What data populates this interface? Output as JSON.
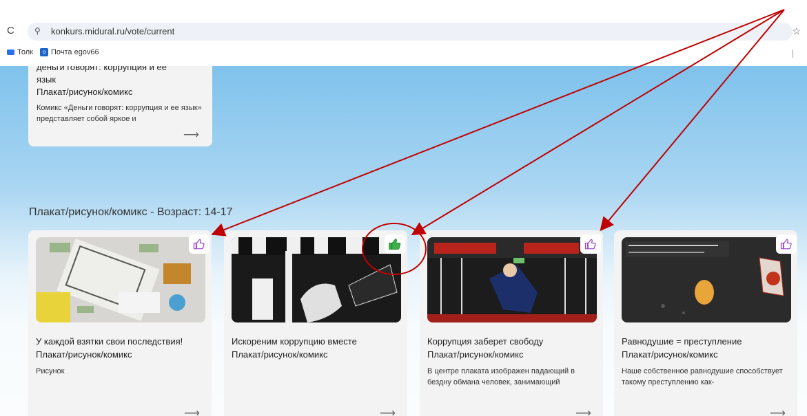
{
  "browser": {
    "url": "konkurs.midural.ru/vote/current",
    "bookmarks": [
      "Толк",
      "Почта egov66"
    ]
  },
  "top_card": {
    "title_line1": "деньги говорят: коррупция и ее",
    "title_line2": "язык",
    "category": "Плакат/рисунок/комикс",
    "description": "Комикс «Деньги говорят: коррупция и ее язык» представляет собой яркое и"
  },
  "section_title": "Плакат/рисунок/комикс - Возраст: 14-17",
  "cards": [
    {
      "title": "У каждой взятки свои последствия!",
      "category": "Плакат/рисунок/комикс",
      "description": "Рисунок",
      "liked": false
    },
    {
      "title": "Искореним коррупцию вместе",
      "category": "Плакат/рисунок/комикс",
      "description": "",
      "liked": true
    },
    {
      "title": "Коррупция заберет свободу",
      "category": "Плакат/рисунок/комикс",
      "description": "В центре плаката изображен падающий в бездну обмана человек, занимающий",
      "liked": false
    },
    {
      "title": "Равнодушие = преступление",
      "category": "Плакат/рисунок/комикс",
      "description": "Наше собственное равнодушие способствует такому преступлению как-",
      "liked": false
    }
  ],
  "arrow_glyph": "⟶",
  "colors": {
    "like_purple": "#9b4fc9",
    "like_green": "#3cb34a",
    "annotation_red": "#c00000"
  }
}
